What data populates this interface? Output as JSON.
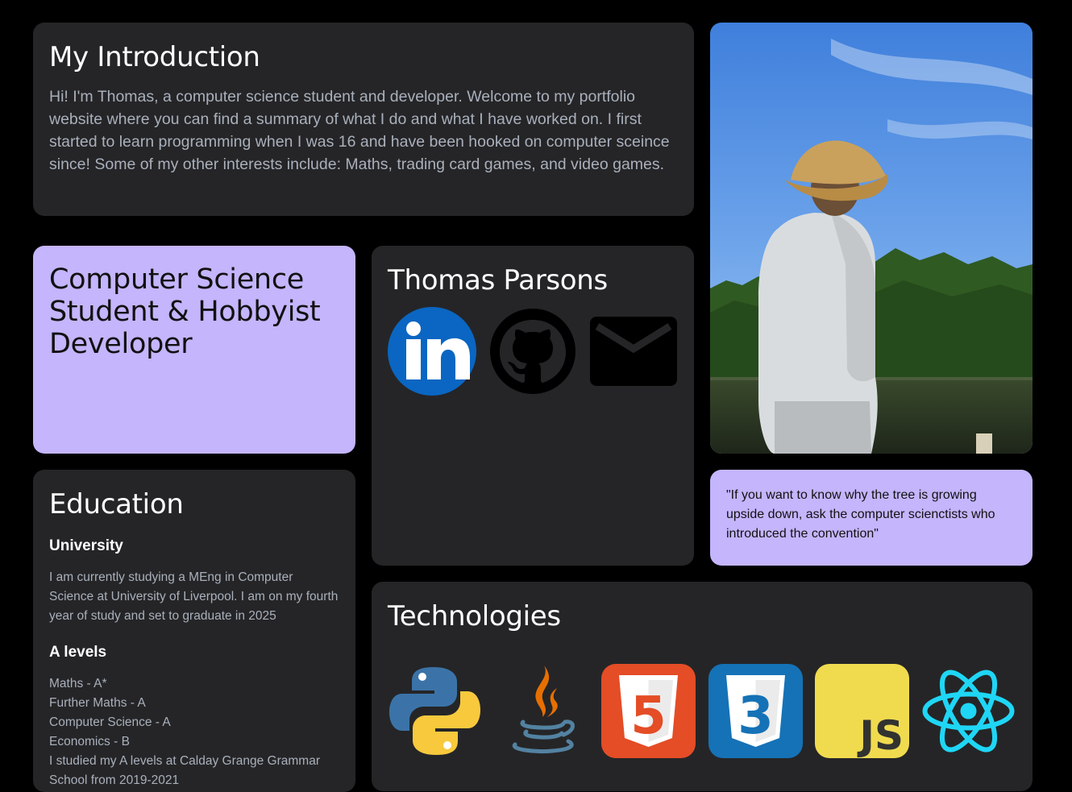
{
  "intro": {
    "title": "My Introduction",
    "text": "Hi! I'm Thomas, a computer science student and developer. Welcome to my portfolio website where you can find a summary of what I do and what I have worked on. I first started to learn programming when I was 16 and have been hooked on computer sceince since! Some of my other interests include: Maths, trading card games, and video games."
  },
  "role": {
    "title": "Computer Science Student & Hobbyist Developer"
  },
  "contact": {
    "name": "Thomas Parsons",
    "links": [
      {
        "icon": "linkedin-icon"
      },
      {
        "icon": "github-icon"
      },
      {
        "icon": "email-icon"
      }
    ]
  },
  "photo": {
    "icon": "profile-photo"
  },
  "quote": {
    "text": "\"If you want to know why the tree is growing upside down, ask the computer scienctists who introduced the convention\""
  },
  "education": {
    "title": "Education",
    "university_heading": "University",
    "university_text": "I am currently studying a MEng in Computer Science at University of Liverpool. I am on my fourth year of study and set to graduate in 2025",
    "alevels_heading": "A levels",
    "alevels": [
      "Maths - A*",
      "Further Maths - A",
      "Computer Science - A",
      "Economics - B",
      "I studied my A levels at Calday Grange Grammar School from 2019-2021"
    ]
  },
  "technologies": {
    "title": "Technologies",
    "icons": [
      "python-icon",
      "java-icon",
      "html5-icon",
      "css3-icon",
      "javascript-icon",
      "react-icon"
    ],
    "labels": {
      "html": "5",
      "css": "3",
      "js": "JS"
    },
    "colors": {
      "python_blue": "#3b73a8",
      "python_yellow": "#f8c93d",
      "java_orange": "#e76f00",
      "java_blue": "#5382a1",
      "html": "#e44d26",
      "css": "#1572b6",
      "js": "#f0db4f",
      "react": "#1fd6f5"
    }
  },
  "colors": {
    "background": "#000000",
    "card": "#252527",
    "accent": "#c4b5fc",
    "muted_text": "#a9b0bc"
  }
}
